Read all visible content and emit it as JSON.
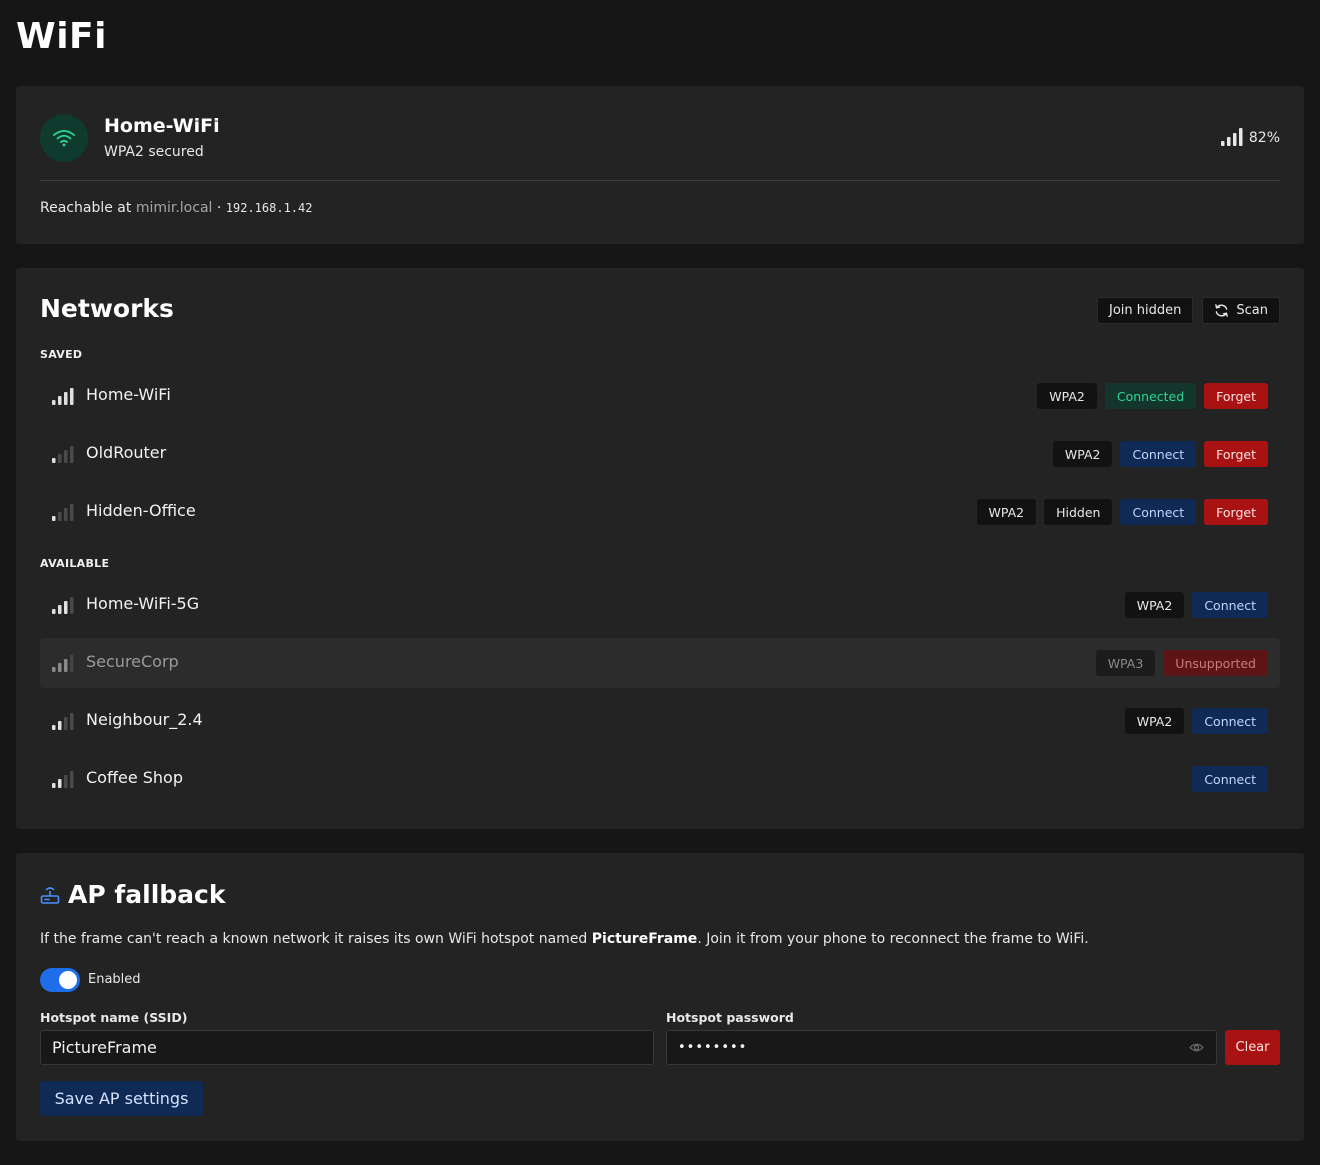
{
  "page": {
    "title": "WiFi"
  },
  "status": {
    "ssid": "Home-WiFi",
    "security": "WPA2 secured",
    "signal": "82%",
    "reachable_prefix": "Reachable at",
    "hostname": "mimir.local",
    "separator": "·",
    "ip": "192.168.1.42",
    "icon": "wifi-icon",
    "accent": "#2fd69a"
  },
  "networks": {
    "title": "Networks",
    "join_hidden_label": "Join hidden",
    "scan_label": "Scan",
    "saved_label": "SAVED",
    "available_label": "AVAILABLE",
    "saved": [
      {
        "name": "Home-WiFi",
        "signal_bars": 4,
        "tags": [
          {
            "type": "sec",
            "text": "WPA2"
          },
          {
            "type": "connected",
            "text": "Connected"
          },
          {
            "type": "forget",
            "text": "Forget"
          }
        ]
      },
      {
        "name": "OldRouter",
        "signal_bars": 1,
        "tags": [
          {
            "type": "sec",
            "text": "WPA2"
          },
          {
            "type": "connect",
            "text": "Connect"
          },
          {
            "type": "forget",
            "text": "Forget"
          }
        ]
      },
      {
        "name": "Hidden-Office",
        "signal_bars": 1,
        "tags": [
          {
            "type": "sec",
            "text": "WPA2"
          },
          {
            "type": "sec",
            "text": "Hidden"
          },
          {
            "type": "connect",
            "text": "Connect"
          },
          {
            "type": "forget",
            "text": "Forget"
          }
        ]
      }
    ],
    "available": [
      {
        "name": "Home-WiFi-5G",
        "signal_bars": 3,
        "tags": [
          {
            "type": "sec",
            "text": "WPA2"
          },
          {
            "type": "connect",
            "text": "Connect"
          }
        ]
      },
      {
        "name": "SecureCorp",
        "signal_bars": 3,
        "muted": true,
        "tags": [
          {
            "type": "sec-dim",
            "text": "WPA3"
          },
          {
            "type": "unsupported",
            "text": "Unsupported"
          }
        ]
      },
      {
        "name": "Neighbour_2.4",
        "signal_bars": 2,
        "tags": [
          {
            "type": "sec",
            "text": "WPA2"
          },
          {
            "type": "connect",
            "text": "Connect"
          }
        ]
      },
      {
        "name": "Coffee Shop",
        "signal_bars": 2,
        "tags": [
          {
            "type": "connect",
            "text": "Connect"
          }
        ]
      }
    ]
  },
  "ap": {
    "title": "AP fallback",
    "icon": "router-icon",
    "desc_before": "If the frame can't reach a known network it raises its own WiFi hotspot named ",
    "desc_name": "PictureFrame",
    "desc_after": ". Join it from your phone to reconnect the frame to WiFi.",
    "enabled_label": "Enabled",
    "enabled": true,
    "ssid_label": "Hotspot name (SSID)",
    "ssid_value": "PictureFrame",
    "password_label": "Hotspot password",
    "password_value": "••••••••",
    "clear_label": "Clear",
    "save_label": "Save AP settings"
  }
}
